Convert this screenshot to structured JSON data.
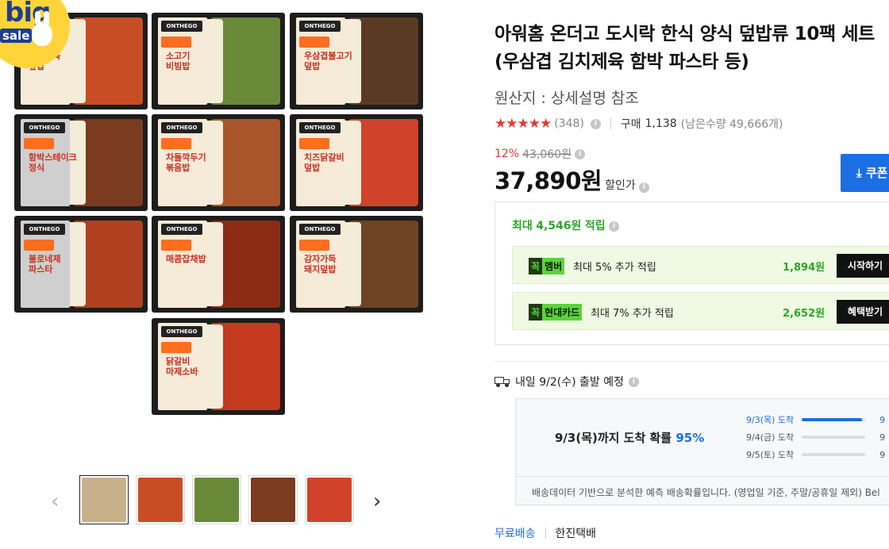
{
  "badge": {
    "big": "big",
    "sale": "sale"
  },
  "tiles": [
    {
      "brand": "ONTHEGO",
      "name": "김치제육 덮밥",
      "food": "#c94d24",
      "label": "light",
      "pos": "r1c1"
    },
    {
      "brand": "ONTHEGO",
      "name": "소고기 비빔밥",
      "food": "#6a8a3a",
      "label": "light",
      "pos": "r1c2"
    },
    {
      "brand": "ONTHEGO",
      "name": "우삼겹불고기 덮밥",
      "food": "#5b3a25",
      "label": "light",
      "pos": "r1c3"
    },
    {
      "brand": "ONTHEGO",
      "name": "함박스테이크 정식",
      "food": "#7a3b1f",
      "label": "grey",
      "pos": "r2c1"
    },
    {
      "brand": "ONTHEGO",
      "name": "차돌깍두기 볶음밥",
      "food": "#a8552c",
      "label": "light",
      "pos": "r2c2"
    },
    {
      "brand": "ONTHEGO",
      "name": "치즈닭갈비 덮밥",
      "food": "#d0432a",
      "label": "light",
      "pos": "r2c3"
    },
    {
      "brand": "ONTHEGO",
      "name": "볼로네제 파스타",
      "food": "#b0401f",
      "label": "grey",
      "pos": "r3c1"
    },
    {
      "brand": "ONTHEGO",
      "name": "매콤잡채밥",
      "food": "#8b2b16",
      "label": "light",
      "pos": "r3c2"
    },
    {
      "brand": "ONTHEGO",
      "name": "감자가득 돼지덮밥",
      "food": "#6e4326",
      "label": "light",
      "pos": "r3c3"
    },
    {
      "brand": "ONTHEGO",
      "name": "닭갈비 마제소바",
      "food": "#c33a1f",
      "label": "light",
      "pos": "r4c2"
    }
  ],
  "thumbnails": [
    {
      "name": "thumb-set",
      "color": "#c8b08a",
      "active": true
    },
    {
      "name": "thumb-kimchi-jeyuk",
      "color": "#c94d24",
      "active": false
    },
    {
      "name": "thumb-bibimbap",
      "color": "#6a8a3a",
      "active": false
    },
    {
      "name": "thumb-hamburg",
      "color": "#7a3b1f",
      "active": false
    },
    {
      "name": "thumb-chicken",
      "color": "#d0432a",
      "active": false
    }
  ],
  "product": {
    "title": "아워홈 온더고 도시락 한식 양식 덮밥류 10팩 세트(우삼겹 김치제육 함박 파스타 등)",
    "origin": "원산지 : 상세설명 참조",
    "rating_stars": "★★★★★",
    "review_count": "(348)",
    "purchase_label": "구매",
    "purchase_count": "1,138",
    "remaining": "(남은수량 49,666개)",
    "discount_pct": "12%",
    "original_price": "43,060원",
    "price": "37,890원",
    "price_label": "할인가",
    "coupon_label": "⤓ 쿠폰"
  },
  "rewards": {
    "title_prefix": "최대",
    "title_amount": "4,546원",
    "title_suffix": "적립",
    "items": [
      {
        "badge_k": "꼭",
        "badge_n": "멤버",
        "desc": "최대 5% 추가 적립",
        "amount": "1,894원",
        "action": "시작하기"
      },
      {
        "badge_k": "꼭",
        "badge_n": "현대카드",
        "desc": "최대 7% 추가 적립",
        "amount": "2,652원",
        "action": "혜택받기"
      }
    ]
  },
  "shipping": {
    "schedule": "내일 9/2(수) 출발 예정",
    "arrival_prefix": "9/3(목)까지 도착 확률",
    "arrival_pct": "95%",
    "distribution": [
      {
        "label": "9/3(목) 도착",
        "value": 0.95,
        "value_text": "9"
      },
      {
        "label": "9/4(금) 도착",
        "value": 0.0,
        "value_text": "9"
      },
      {
        "label": "9/5(토) 도착",
        "value": 0.0,
        "value_text": "9"
      }
    ],
    "note": "배송데이터 기반으로 분석한 예측 배송확률입니다. (영업일 기준, 주말/공휴일 제외) Bel",
    "free_shipping": "무료배송",
    "carrier": "한진택배"
  },
  "colors": {
    "accent": "#1c6fe3",
    "sale": "#e53935",
    "reward": "#2da628"
  }
}
